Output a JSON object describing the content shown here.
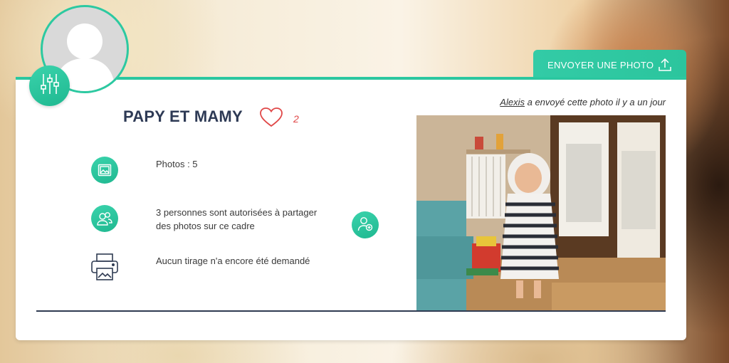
{
  "header": {
    "send_photo_label": "ENVOYER UNE PHOTO"
  },
  "frame": {
    "name": "PAPY ET MAMY",
    "likes": "2"
  },
  "info": {
    "photos": "Photos : 5",
    "shared_line1": "3 personnes sont autorisées à partager",
    "shared_line2": "des photos sur ce cadre",
    "prints": "Aucun tirage n'a encore été demandé"
  },
  "latest_photo": {
    "sender": "Alexis",
    "caption": " a envoyé cette photo il y a un jour"
  },
  "colors": {
    "accent": "#2cc9a1",
    "title": "#2e3a55",
    "like": "#e04848"
  },
  "icons": {
    "settings": "sliders-icon",
    "upload": "upload-icon",
    "photos": "image-icon",
    "users": "users-icon",
    "add_user": "add-user-icon",
    "printer": "printer-icon",
    "like": "heart-icon"
  }
}
